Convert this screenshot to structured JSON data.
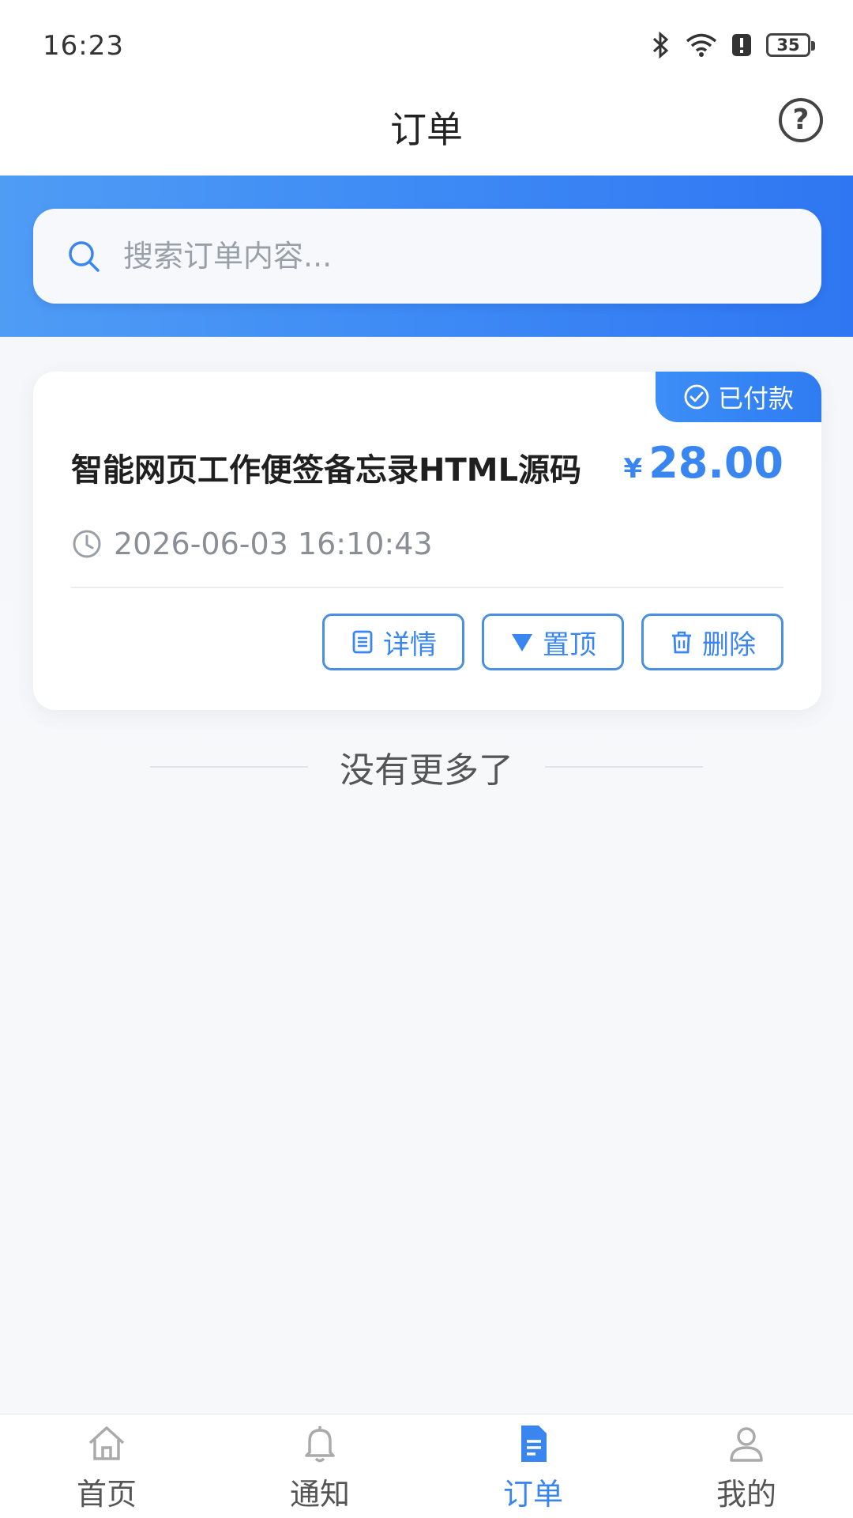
{
  "status_bar": {
    "time": "16:23",
    "battery": "35"
  },
  "nav": {
    "title": "订单"
  },
  "search": {
    "placeholder": "搜索订单内容..."
  },
  "order": {
    "status": "已付款",
    "title": "智能网页工作便签备忘录HTML源码",
    "currency": "¥",
    "price": "28.00",
    "time": "2026-06-03 16:10:43",
    "actions": {
      "detail": "详情",
      "pin": "置顶",
      "delete": "删除"
    }
  },
  "list_end": "没有更多了",
  "tabs": [
    {
      "label": "首页",
      "icon": "home-icon",
      "active": false
    },
    {
      "label": "通知",
      "icon": "bell-icon",
      "active": false
    },
    {
      "label": "订单",
      "icon": "document-icon",
      "active": true
    },
    {
      "label": "我的",
      "icon": "user-icon",
      "active": false
    }
  ],
  "colors": {
    "accent": "#3a86f0",
    "header_gradient_start": "#4f9cf5",
    "header_gradient_end": "#2f76f2"
  }
}
